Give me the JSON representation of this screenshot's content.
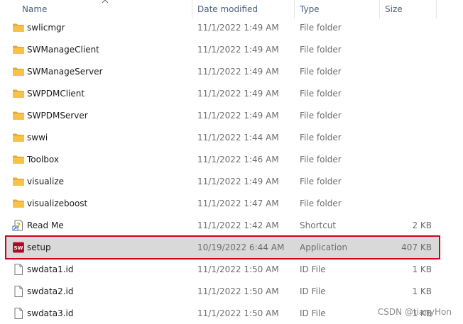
{
  "columns": {
    "name": "Name",
    "date_modified": "Date modified",
    "type": "Type",
    "size": "Size"
  },
  "rows": [
    {
      "name": "swlicmgr",
      "date": "11/1/2022 1:49 AM",
      "type": "File folder",
      "size": "",
      "icon": "folder-icon"
    },
    {
      "name": "SWManageClient",
      "date": "11/1/2022 1:49 AM",
      "type": "File folder",
      "size": "",
      "icon": "folder-icon"
    },
    {
      "name": "SWManageServer",
      "date": "11/1/2022 1:49 AM",
      "type": "File folder",
      "size": "",
      "icon": "folder-icon"
    },
    {
      "name": "SWPDMClient",
      "date": "11/1/2022 1:49 AM",
      "type": "File folder",
      "size": "",
      "icon": "folder-icon"
    },
    {
      "name": "SWPDMServer",
      "date": "11/1/2022 1:49 AM",
      "type": "File folder",
      "size": "",
      "icon": "folder-icon"
    },
    {
      "name": "swwi",
      "date": "11/1/2022 1:44 AM",
      "type": "File folder",
      "size": "",
      "icon": "folder-icon"
    },
    {
      "name": "Toolbox",
      "date": "11/1/2022 1:46 AM",
      "type": "File folder",
      "size": "",
      "icon": "folder-icon"
    },
    {
      "name": "visualize",
      "date": "11/1/2022 1:49 AM",
      "type": "File folder",
      "size": "",
      "icon": "folder-icon"
    },
    {
      "name": "visualizeboost",
      "date": "11/1/2022 1:47 AM",
      "type": "File folder",
      "size": "",
      "icon": "folder-icon"
    },
    {
      "name": "Read Me",
      "date": "11/1/2022 1:42 AM",
      "type": "Shortcut",
      "size": "2 KB",
      "icon": "shortcut-help-icon"
    },
    {
      "name": "setup",
      "date": "10/19/2022 6:44 AM",
      "type": "Application",
      "size": "407 KB",
      "icon": "solidworks-app-icon",
      "selected": true
    },
    {
      "name": "swdata1.id",
      "date": "11/1/2022 1:50 AM",
      "type": "ID File",
      "size": "1 KB",
      "icon": "file-icon"
    },
    {
      "name": "swdata2.id",
      "date": "11/1/2022 1:50 AM",
      "type": "ID File",
      "size": "1 KB",
      "icon": "file-icon"
    },
    {
      "name": "swdata3.id",
      "date": "11/1/2022 1:50 AM",
      "type": "ID File",
      "size": "1 KB",
      "icon": "file-icon"
    }
  ],
  "watermark": "CSDN @tianyHon",
  "colors": {
    "selection_border": "#d0021b",
    "selection_fill": "#d9d9d9",
    "header_text": "#4c607a",
    "folder": "#f8c24a"
  }
}
